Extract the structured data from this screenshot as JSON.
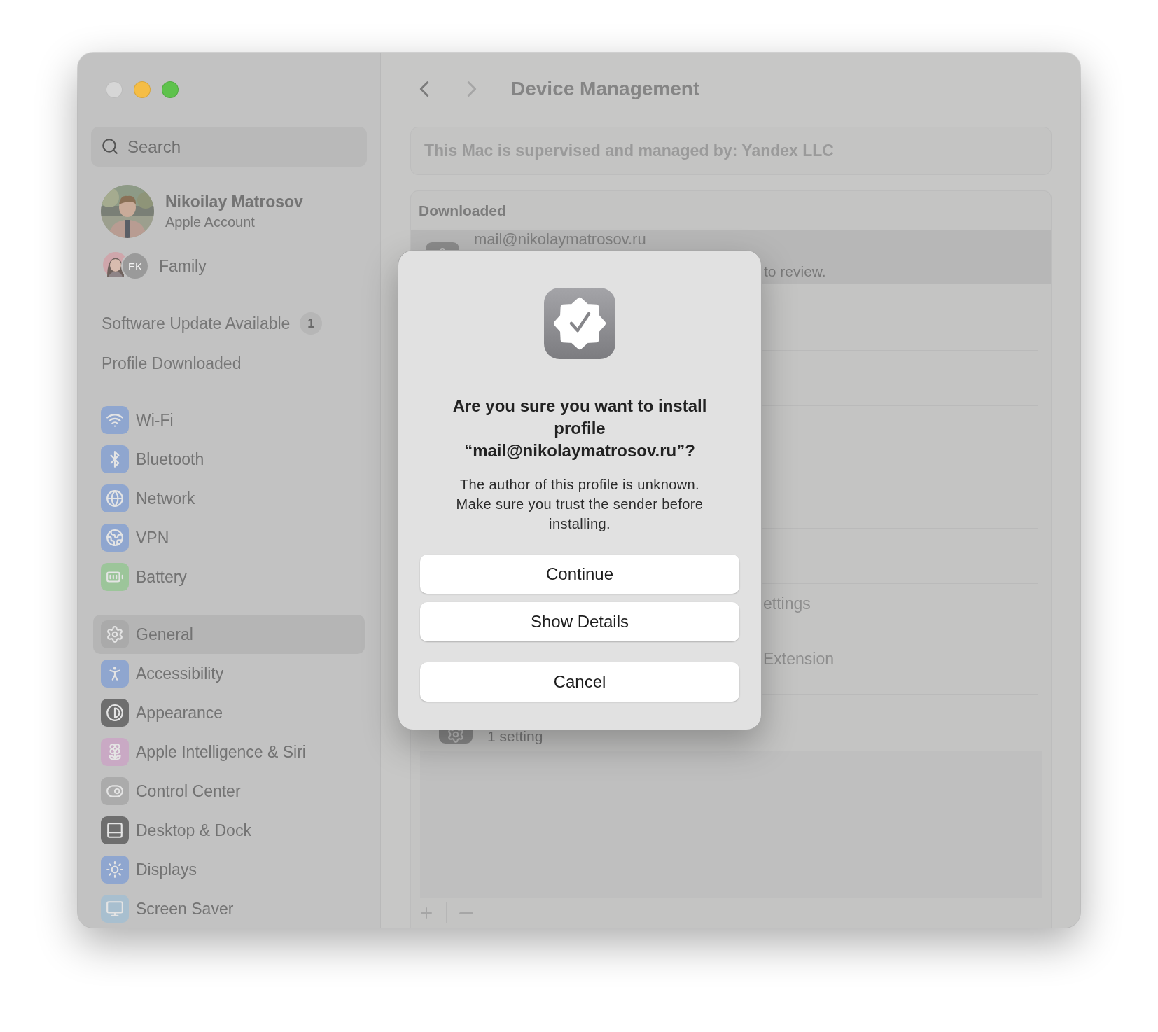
{
  "window": {
    "controls": [
      {
        "color": "#d6d6d6"
      },
      {
        "color": "#f5bd45"
      },
      {
        "color": "#5ec24c"
      }
    ]
  },
  "sidebar": {
    "search": {
      "placeholder": "Search"
    },
    "account": {
      "name": "Nikoilay Matrosov",
      "subtitle": "Apple Account"
    },
    "family": {
      "initials": "EK",
      "label": "Family"
    },
    "notices": [
      {
        "label": "Software Update Available",
        "badge": "1"
      },
      {
        "label": "Profile Downloaded"
      }
    ],
    "groups": [
      [
        {
          "label": "Wi-Fi",
          "color": "#8fa6cf",
          "selected": false
        },
        {
          "label": "Bluetooth",
          "color": "#8fa6cf",
          "selected": false
        },
        {
          "label": "Network",
          "color": "#8fa6cf",
          "selected": false
        },
        {
          "label": "VPN",
          "color": "#8fa6cf",
          "selected": false
        },
        {
          "label": "Battery",
          "color": "#9cc59a",
          "selected": false
        }
      ],
      [
        {
          "label": "General",
          "color": "#aaaaaa",
          "selected": true
        },
        {
          "label": "Accessibility",
          "color": "#8fa6cf",
          "selected": false
        },
        {
          "label": "Appearance",
          "color": "#6e6e6e",
          "selected": false
        },
        {
          "label": "Apple Intelligence & Siri",
          "color": "#c9a9c4",
          "selected": false
        },
        {
          "label": "Control Center",
          "color": "#ababab",
          "selected": false
        },
        {
          "label": "Desktop & Dock",
          "color": "#6e6e6e",
          "selected": false
        },
        {
          "label": "Displays",
          "color": "#8fa6cf",
          "selected": false
        },
        {
          "label": "Screen Saver",
          "color": "#a8bfcf",
          "selected": false
        }
      ]
    ]
  },
  "main": {
    "title": "Device Management",
    "info": "This Mac is supervised and managed by: Yandex LLC",
    "profiles": {
      "header": "Downloaded",
      "rows": [
        {
          "kind": "profile",
          "selected": true,
          "title": "mail@nikolaymatrosov.ru",
          "subtitle": "to review."
        },
        {
          "kind": "partial",
          "selected": false,
          "title": "ettings"
        },
        {
          "kind": "partial",
          "selected": false,
          "title": "Extension"
        },
        {
          "kind": "tail",
          "selected": false,
          "subtitle": "1 setting"
        }
      ]
    }
  },
  "dialog": {
    "title": "Are you sure you want to install profile “mail@nikolaymatrosov.ru”?",
    "message": "The author of this profile is unknown. Make sure you trust the sender before installing.",
    "buttons": [
      {
        "label": "Continue",
        "kind": "action"
      },
      {
        "label": "Show Details",
        "kind": "action"
      },
      {
        "label": "Cancel",
        "kind": "cancel"
      }
    ]
  }
}
